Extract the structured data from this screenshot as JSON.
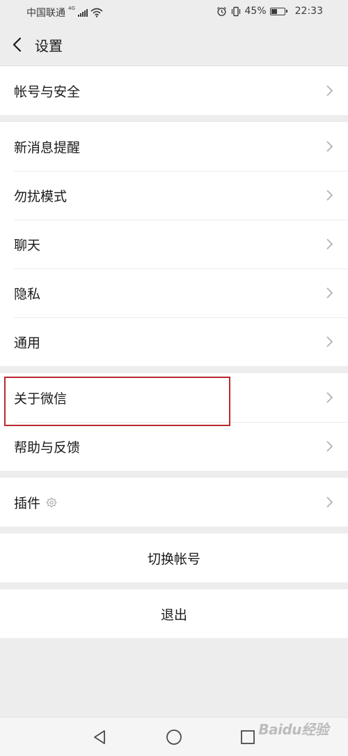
{
  "status_bar": {
    "carrier": "中国联通",
    "network_type": "4G",
    "battery_percent": "45%",
    "battery_level": 0.45,
    "time": "22:33"
  },
  "header": {
    "title": "设置"
  },
  "groups": [
    {
      "items": [
        {
          "label": "帐号与安全"
        }
      ]
    },
    {
      "items": [
        {
          "label": "新消息提醒"
        },
        {
          "label": "勿扰模式"
        },
        {
          "label": "聊天"
        },
        {
          "label": "隐私"
        },
        {
          "label": "通用"
        }
      ]
    },
    {
      "items": [
        {
          "label": "关于微信"
        },
        {
          "label": "帮助与反馈"
        }
      ]
    },
    {
      "items": [
        {
          "label": "插件"
        }
      ]
    }
  ],
  "actions": {
    "switch_account": "切换帐号",
    "logout": "退出"
  },
  "watermark": "Baidu经验",
  "colors": {
    "background": "#ededed",
    "highlight": "#b7282e"
  }
}
